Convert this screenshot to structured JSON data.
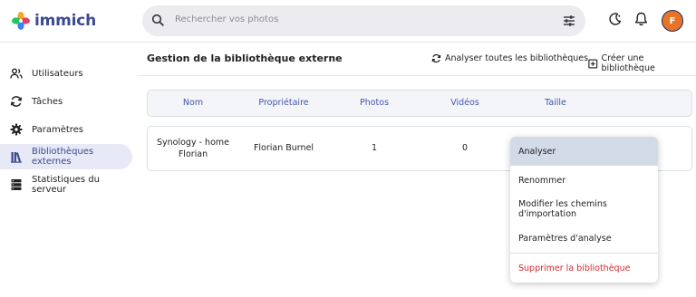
{
  "app": {
    "name": "immich"
  },
  "search": {
    "placeholder": "Rechercher vos photos"
  },
  "user": {
    "avatar_initial": "F",
    "avatar_color": "#e8742a"
  },
  "sidebar": {
    "items": [
      {
        "label": "Utilisateurs",
        "icon": "users-icon"
      },
      {
        "label": "Tâches",
        "icon": "sync-icon"
      },
      {
        "label": "Paramètres",
        "icon": "gear-icon"
      },
      {
        "label": "Bibliothèques externes",
        "icon": "library-icon",
        "active": true
      },
      {
        "label": "Statistiques du serveur",
        "icon": "server-icon"
      }
    ]
  },
  "main": {
    "title": "Gestion de la bibliothèque externe",
    "scan_all_label": "Analyser toutes les bibliothèques",
    "create_label": "Créer une bibliothèque"
  },
  "table": {
    "headers": [
      "Nom",
      "Propriétaire",
      "Photos",
      "Vidéos",
      "Taille"
    ],
    "rows": [
      {
        "name_line1": "Synology - home",
        "name_line2": "Florian",
        "owner": "Florian Burnel",
        "photos": "1",
        "videos": "0"
      }
    ]
  },
  "context_menu": {
    "items": [
      "Analyser",
      "Renommer",
      "Modifier les chemins d'importation",
      "Paramètres d'analyse"
    ],
    "danger_item": "Supprimer la bibliothèque"
  },
  "colors": {
    "accent": "#4454a8",
    "danger": "#d8262c",
    "active_bg": "#e7e9f6"
  }
}
